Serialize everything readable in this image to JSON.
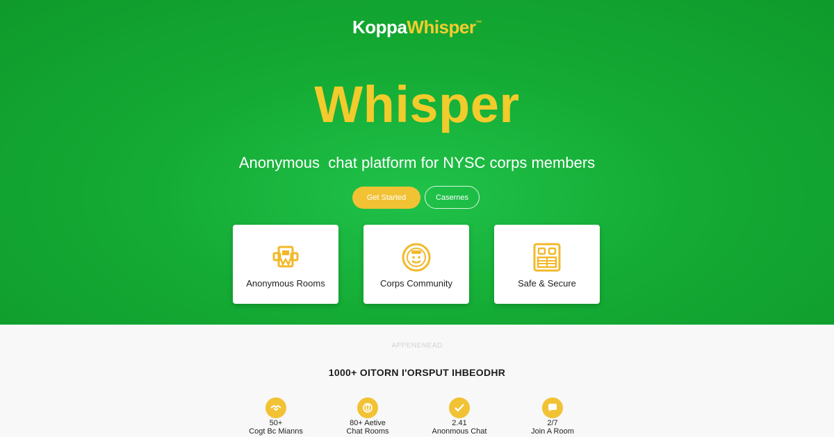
{
  "brand": {
    "part1": "Koppa",
    "part2": "Whisper",
    "trademark": "™"
  },
  "hero": {
    "title": "Whisper",
    "tagline": "Anonymous  chat platform for NYSC corps members"
  },
  "buttons": {
    "primary": "Get Started",
    "secondary": "Casernes"
  },
  "features": [
    {
      "label": "Anonymous Rooms",
      "icon": "rooms-icon"
    },
    {
      "label": "Corps Community",
      "icon": "community-icon"
    },
    {
      "label": "Safe & Secure",
      "icon": "secure-icon"
    }
  ],
  "section": {
    "eyebrow": "APPENENEAD",
    "title": "1000+ OITORN I'ORSPUT IHBEODHR"
  },
  "stats": [
    {
      "value": "50+",
      "label": "Cogt Bc Mianns",
      "icon": "handshake-icon"
    },
    {
      "value": "80+ Aetive",
      "label": "Chat Rooms",
      "icon": "badge-icon"
    },
    {
      "value": "2.41",
      "label": "Anonmous Chat",
      "icon": "check-icon"
    },
    {
      "value": "2/7",
      "label": "Join A Room",
      "icon": "chat-bubble-icon"
    }
  ],
  "colors": {
    "hero_green": "#14ab34",
    "accent_yellow": "#f2c235",
    "white": "#ffffff"
  }
}
